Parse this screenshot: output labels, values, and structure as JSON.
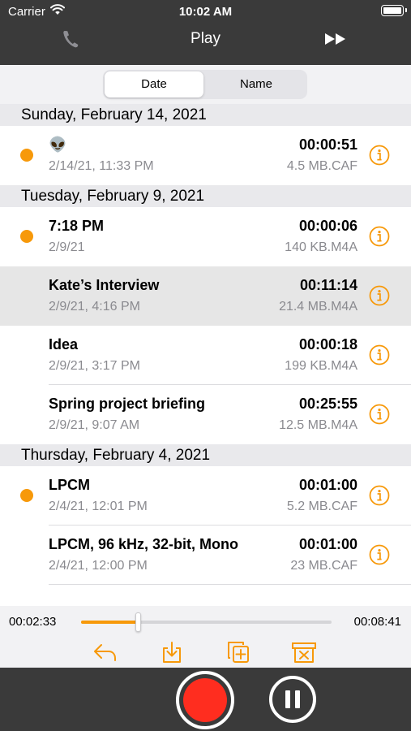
{
  "status": {
    "carrier": "Carrier",
    "time": "10:02 AM"
  },
  "nav": {
    "title": "Play",
    "left_icon": "phone-icon",
    "right_icon": "fast-forward-icon"
  },
  "sort": {
    "options": [
      "Date",
      "Name"
    ],
    "selected": "Date"
  },
  "sections": [
    {
      "header": "Sunday, February 14, 2021",
      "rows": [
        {
          "title": "👽",
          "date": "2/14/21, 11:33 PM",
          "duration": "00:00:51",
          "size": "4.5 MB.CAF",
          "new": true
        }
      ]
    },
    {
      "header": "Tuesday, February 9, 2021",
      "rows": [
        {
          "title": "7:18 PM",
          "date": "2/9/21",
          "duration": "00:00:06",
          "size": "140 KB.M4A",
          "new": true
        },
        {
          "title": "Kate’s Interview",
          "date": "2/9/21, 4:16 PM",
          "duration": "00:11:14",
          "size": "21.4 MB.M4A",
          "new": false,
          "selected": true
        },
        {
          "title": "Idea",
          "date": "2/9/21, 3:17 PM",
          "duration": "00:00:18",
          "size": "199 KB.M4A",
          "new": false
        },
        {
          "title": "Spring project briefing",
          "date": "2/9/21, 9:07 AM",
          "duration": "00:25:55",
          "size": "12.5 MB.M4A",
          "new": false
        }
      ]
    },
    {
      "header": "Thursday, February 4, 2021",
      "rows": [
        {
          "title": "LPCM",
          "date": "2/4/21, 12:01 PM",
          "duration": "00:01:00",
          "size": "5.2 MB.CAF",
          "new": true
        },
        {
          "title": "LPCM, 96 kHz, 32-bit, Mono",
          "date": "2/4/21, 12:00 PM",
          "duration": "00:01:00",
          "size": "23 MB.CAF",
          "new": false
        }
      ]
    }
  ],
  "player": {
    "elapsed": "00:02:33",
    "total": "00:08:41",
    "progress": 0.2265,
    "tools": [
      "reply-icon",
      "download-icon",
      "copy-add-icon",
      "delete-icon"
    ]
  },
  "controls": {
    "record": "record-button",
    "pause": "pause-button"
  },
  "colors": {
    "accent": "#f7990a",
    "bar": "#3a3a3a",
    "record": "#ff2d1f"
  }
}
